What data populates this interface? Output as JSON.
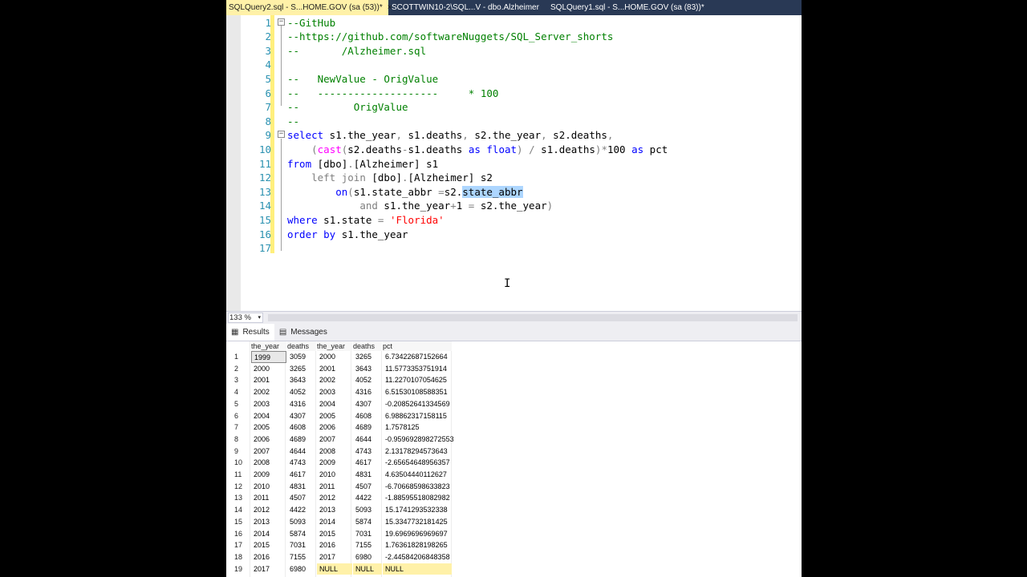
{
  "tabs": [
    {
      "label": "SQLQuery2.sql - S...HOME.GOV (sa (53))*",
      "close": "×"
    },
    {
      "label": "SCOTTWIN10-2\\SQL...V - dbo.Alzheimer"
    },
    {
      "label": "SQLQuery1.sql - S...HOME.GOV (sa (83))*"
    }
  ],
  "editor": {
    "line_numbers": [
      "1",
      "2",
      "3",
      "4",
      "5",
      "6",
      "7",
      "8",
      "9",
      "10",
      "11",
      "12",
      "13",
      "14",
      "15",
      "16",
      "17"
    ],
    "fold_markers": [
      "−",
      "−"
    ],
    "lines": [
      {
        "segments": [
          {
            "t": "--GitHub",
            "c": "cmt"
          }
        ]
      },
      {
        "segments": [
          {
            "t": "--https://github.com/softwareNuggets/SQL_Server_shorts",
            "c": "cmt"
          }
        ]
      },
      {
        "segments": [
          {
            "t": "--       /Alzheimer.sql",
            "c": "cmt"
          }
        ]
      },
      {
        "segments": []
      },
      {
        "segments": [
          {
            "t": "--   NewValue - OrigValue",
            "c": "cmt"
          }
        ]
      },
      {
        "segments": [
          {
            "t": "--   --------------------     * 100",
            "c": "cmt"
          }
        ]
      },
      {
        "segments": [
          {
            "t": "--         OrigValue",
            "c": "cmt"
          }
        ]
      },
      {
        "segments": [
          {
            "t": "--",
            "c": "cmt"
          }
        ]
      },
      {
        "segments": [
          {
            "t": "select",
            "c": "kw"
          },
          {
            "t": " s1.the_year",
            "c": ""
          },
          {
            "t": ",",
            "c": "op"
          },
          {
            "t": " s1.deaths",
            "c": ""
          },
          {
            "t": ",",
            "c": "op"
          },
          {
            "t": " s2.the_year",
            "c": ""
          },
          {
            "t": ",",
            "c": "op"
          },
          {
            "t": " s2.deaths",
            "c": ""
          },
          {
            "t": ",",
            "c": "op"
          }
        ]
      },
      {
        "segments": [
          {
            "t": "    ",
            "c": ""
          },
          {
            "t": "(",
            "c": "op"
          },
          {
            "t": "cast",
            "c": "fn"
          },
          {
            "t": "(",
            "c": "op"
          },
          {
            "t": "s2.deaths",
            "c": ""
          },
          {
            "t": "-",
            "c": "op"
          },
          {
            "t": "s1.deaths ",
            "c": ""
          },
          {
            "t": "as",
            "c": "kw"
          },
          {
            "t": " ",
            "c": ""
          },
          {
            "t": "float",
            "c": "kw"
          },
          {
            "t": ")",
            "c": "op"
          },
          {
            "t": " ",
            "c": ""
          },
          {
            "t": "/",
            "c": "op"
          },
          {
            "t": " s1.deaths",
            "c": ""
          },
          {
            "t": ")",
            "c": "op"
          },
          {
            "t": "*",
            "c": "op"
          },
          {
            "t": "100 ",
            "c": ""
          },
          {
            "t": "as",
            "c": "kw"
          },
          {
            "t": " pct",
            "c": ""
          }
        ]
      },
      {
        "segments": [
          {
            "t": "from",
            "c": "kw"
          },
          {
            "t": " [dbo]",
            "c": ""
          },
          {
            "t": ".",
            "c": "op"
          },
          {
            "t": "[Alzheimer] s1",
            "c": ""
          }
        ]
      },
      {
        "segments": [
          {
            "t": "    ",
            "c": ""
          },
          {
            "t": "left join",
            "c": "op"
          },
          {
            "t": " [dbo]",
            "c": ""
          },
          {
            "t": ".",
            "c": "op"
          },
          {
            "t": "[Alzheimer] s2",
            "c": ""
          }
        ]
      },
      {
        "segments": [
          {
            "t": "        ",
            "c": ""
          },
          {
            "t": "on",
            "c": "kw"
          },
          {
            "t": "(",
            "c": "op"
          },
          {
            "t": "s1.state_abbr ",
            "c": ""
          },
          {
            "t": "=",
            "c": "op"
          },
          {
            "t": "s2.",
            "c": ""
          },
          {
            "t": "state_abbr",
            "c": "sel"
          }
        ]
      },
      {
        "segments": [
          {
            "t": "            ",
            "c": ""
          },
          {
            "t": "and",
            "c": "op"
          },
          {
            "t": " s1.the_year",
            "c": ""
          },
          {
            "t": "+",
            "c": "op"
          },
          {
            "t": "1 ",
            "c": ""
          },
          {
            "t": "=",
            "c": "op"
          },
          {
            "t": " s2.the_year",
            "c": ""
          },
          {
            "t": ")",
            "c": "op"
          }
        ]
      },
      {
        "segments": [
          {
            "t": "where",
            "c": "kw"
          },
          {
            "t": " s1.state ",
            "c": ""
          },
          {
            "t": "=",
            "c": "op"
          },
          {
            "t": " ",
            "c": ""
          },
          {
            "t": "'Florida'",
            "c": "str"
          }
        ]
      },
      {
        "segments": [
          {
            "t": "order by",
            "c": "kw"
          },
          {
            "t": " s1.the_year",
            "c": ""
          }
        ]
      },
      {
        "segments": []
      }
    ]
  },
  "zoom": {
    "value": "133 %",
    "caret": "▾"
  },
  "result_tabs": [
    {
      "label": "Results",
      "icon": "grid-icon",
      "glyph": "▦"
    },
    {
      "label": "Messages",
      "icon": "messages-icon",
      "glyph": "▤"
    }
  ],
  "grid": {
    "columns": [
      "the_year",
      "deaths",
      "the_year",
      "deaths",
      "pct"
    ],
    "rows": [
      [
        "1",
        "1999",
        "3059",
        "2000",
        "3265",
        "6.73422687152664"
      ],
      [
        "2",
        "2000",
        "3265",
        "2001",
        "3643",
        "11.5773353751914"
      ],
      [
        "3",
        "2001",
        "3643",
        "2002",
        "4052",
        "11.2270107054625"
      ],
      [
        "4",
        "2002",
        "4052",
        "2003",
        "4316",
        "6.51530108588351"
      ],
      [
        "5",
        "2003",
        "4316",
        "2004",
        "4307",
        "-0.20852641334569"
      ],
      [
        "6",
        "2004",
        "4307",
        "2005",
        "4608",
        "6.98862317158115"
      ],
      [
        "7",
        "2005",
        "4608",
        "2006",
        "4689",
        "1.7578125"
      ],
      [
        "8",
        "2006",
        "4689",
        "2007",
        "4644",
        "-0.959692898272553"
      ],
      [
        "9",
        "2007",
        "4644",
        "2008",
        "4743",
        "2.13178294573643"
      ],
      [
        "10",
        "2008",
        "4743",
        "2009",
        "4617",
        "-2.65654648956357"
      ],
      [
        "11",
        "2009",
        "4617",
        "2010",
        "4831",
        "4.63504440112627"
      ],
      [
        "12",
        "2010",
        "4831",
        "2011",
        "4507",
        "-6.70668598633823"
      ],
      [
        "13",
        "2011",
        "4507",
        "2012",
        "4422",
        "-1.88595518082982"
      ],
      [
        "14",
        "2012",
        "4422",
        "2013",
        "5093",
        "15.1741293532338"
      ],
      [
        "15",
        "2013",
        "5093",
        "2014",
        "5874",
        "15.3347732181425"
      ],
      [
        "16",
        "2014",
        "5874",
        "2015",
        "7031",
        "19.6969696969697"
      ],
      [
        "17",
        "2015",
        "7031",
        "2016",
        "7155",
        "1.76361828198265"
      ],
      [
        "18",
        "2016",
        "7155",
        "2017",
        "6980",
        "-2.44584206848358"
      ],
      [
        "19",
        "2017",
        "6980",
        "NULL",
        "NULL",
        "NULL"
      ]
    ]
  }
}
